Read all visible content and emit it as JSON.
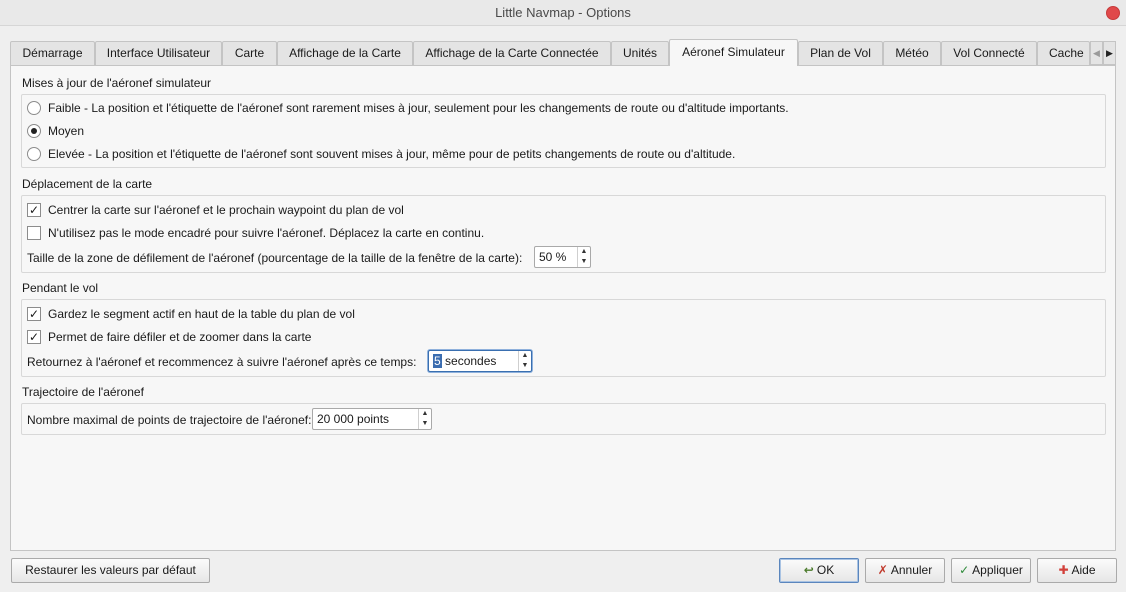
{
  "window": {
    "title": "Little Navmap - Options"
  },
  "tabs": [
    {
      "label": "Démarrage"
    },
    {
      "label": "Interface Utilisateur"
    },
    {
      "label": "Carte"
    },
    {
      "label": "Affichage de la Carte"
    },
    {
      "label": "Affichage de la Carte Connectée"
    },
    {
      "label": "Unités"
    },
    {
      "label": "Aéronef Simulateur"
    },
    {
      "label": "Plan de Vol"
    },
    {
      "label": "Météo"
    },
    {
      "label": "Vol Connecté"
    },
    {
      "label": "Cache"
    }
  ],
  "active_tab": "Aéronef Simulateur",
  "updates": {
    "title": "Mises à jour de l'aéronef simulateur",
    "options": [
      {
        "label": "Faible - La position et l'étiquette de l'aéronef sont rarement mises à jour, seulement pour les changements de route ou d'altitude importants.",
        "selected": false
      },
      {
        "label": "Moyen",
        "selected": true
      },
      {
        "label": "Elevée - La position et l'étiquette de l'aéronef sont souvent mises à jour, même pour de petits changements de route ou d'altitude.",
        "selected": false
      }
    ]
  },
  "map_move": {
    "title": "Déplacement de la carte",
    "center_label": "Centrer la carte sur l'aéronef et le prochain waypoint du plan de vol",
    "center_checked": true,
    "no_box_label": "N'utilisez pas le mode encadré pour suivre l'aéronef. Déplacez la carte en continu.",
    "no_box_checked": false,
    "scroll_zone_label": "Taille de la zone de défilement de l'aéronef (pourcentage de la taille de la fenêtre de la carte):",
    "scroll_zone_value": "50 %"
  },
  "flying": {
    "title": "Pendant le vol",
    "keep_segment_label": "Gardez le segment actif en haut de la table du plan de vol",
    "keep_segment_checked": true,
    "allow_scroll_label": "Permet de faire défiler et de zoomer dans la carte",
    "allow_scroll_checked": true,
    "return_label": "Retournez à l'aéronef et recommencez à suivre l'aéronef après ce temps:",
    "return_value_selected": "5",
    "return_value_unit": "secondes"
  },
  "trail": {
    "title": "Trajectoire de l'aéronef",
    "max_points_label": "Nombre maximal de points de trajectoire de l'aéronef:",
    "max_points_value": "20 000 points"
  },
  "buttons": {
    "restore": "Restaurer les valeurs par défaut",
    "ok": "OK",
    "cancel": "Annuler",
    "apply": "Appliquer",
    "help": "Aide"
  },
  "icons": {
    "check_mark": "✓",
    "spin_up": "▲",
    "spin_down": "▼",
    "tab_left": "◀",
    "tab_right": "▶"
  }
}
